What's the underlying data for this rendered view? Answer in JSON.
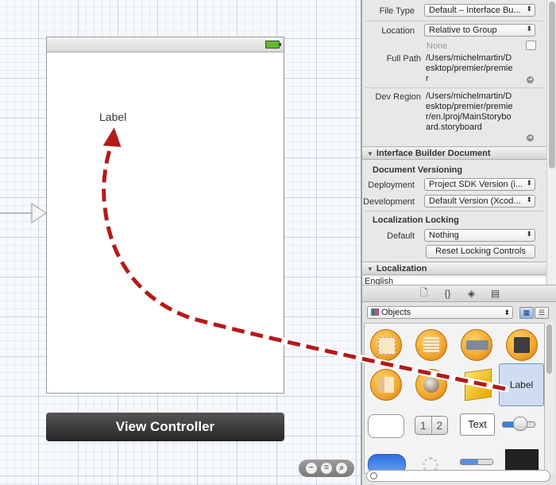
{
  "canvas": {
    "scene_label": "Label",
    "view_controller_title": "View Controller"
  },
  "inspector": {
    "file_type": {
      "label": "File Type",
      "value": "Default – Interface Bu..."
    },
    "location": {
      "label": "Location",
      "value": "Relative to Group",
      "sub_value": "None"
    },
    "full_path": {
      "label": "Full Path",
      "value": "/Users/michelmartin/Desktop/premier/premier"
    },
    "dev_region": {
      "label": "Dev Region",
      "value": "/Users/michelmartin/Desktop/premier/premier/en.lproj/MainStoryboard.storyboard"
    },
    "ib_section_title": "Interface Builder Document",
    "doc_versioning_title": "Document Versioning",
    "deployment": {
      "label": "Deployment",
      "value": "Project SDK Version (i..."
    },
    "development": {
      "label": "Development",
      "value": "Default Version (Xcod..."
    },
    "localization_locking_title": "Localization Locking",
    "default_locking": {
      "label": "Default",
      "value": "Nothing"
    },
    "reset_button": "Reset Locking Controls",
    "localization_section_title": "Localization",
    "localization_first": "English"
  },
  "library": {
    "tabs": [
      "file-template-icon",
      "code-snippet-icon",
      "object-cube-icon",
      "media-icon"
    ],
    "objects_filter": "Objects",
    "label_item": "Label",
    "segmented_1": "1",
    "segmented_2": "2",
    "text_field_item": "Text"
  },
  "colors": {
    "arrow": "#b31a1a",
    "icon_gold": "#f3a52c",
    "selected_item": "#cfdcf2"
  }
}
